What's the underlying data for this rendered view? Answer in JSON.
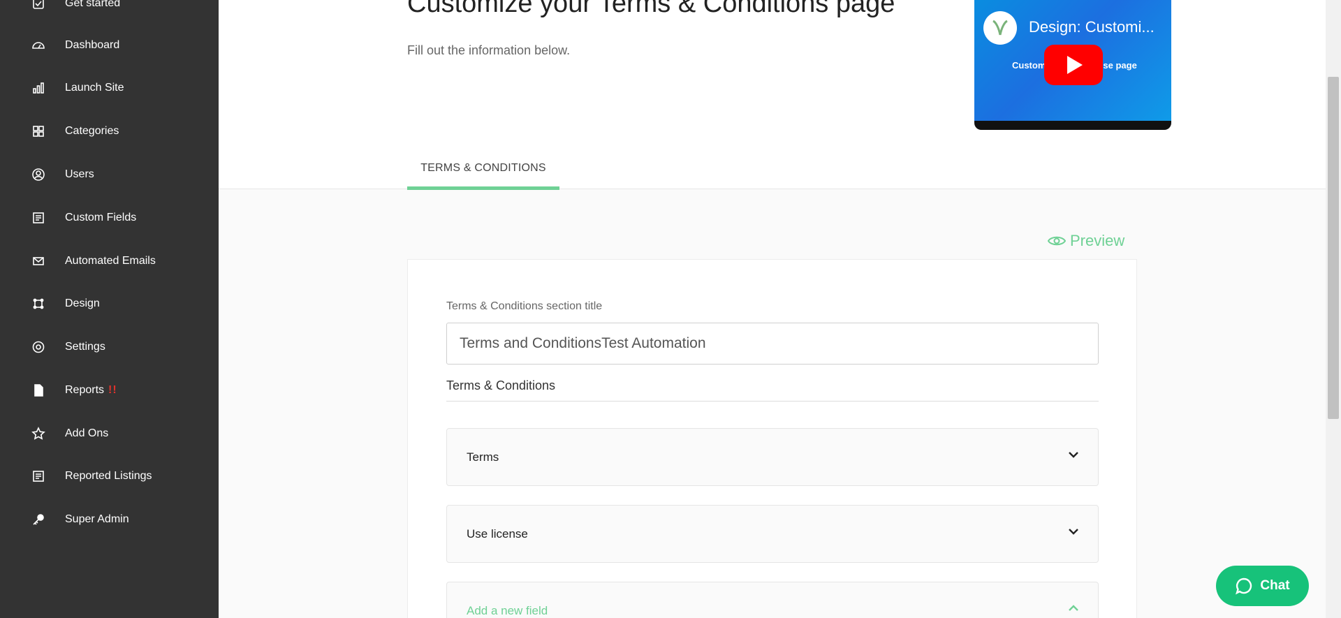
{
  "sidebar": {
    "items": [
      {
        "label": "Get started",
        "icon": "checkbox-icon"
      },
      {
        "label": "Dashboard",
        "icon": "gauge-icon"
      },
      {
        "label": "Launch Site",
        "icon": "bar-chart-icon"
      },
      {
        "label": "Categories",
        "icon": "grid-icon"
      },
      {
        "label": "Users",
        "icon": "user-circle-icon"
      },
      {
        "label": "Custom Fields",
        "icon": "list-icon"
      },
      {
        "label": "Automated Emails",
        "icon": "mail-icon"
      },
      {
        "label": "Design",
        "icon": "frame-icon"
      },
      {
        "label": "Settings",
        "icon": "gear-icon"
      },
      {
        "label": "Reports",
        "icon": "document-icon",
        "alert": "!!"
      },
      {
        "label": "Add Ons",
        "icon": "star-icon"
      },
      {
        "label": "Reported Listings",
        "icon": "list-icon"
      },
      {
        "label": "Super Admin",
        "icon": "key-icon"
      }
    ]
  },
  "header": {
    "title": "Customize your Terms & Conditions page",
    "subtitle": "Fill out the information below.",
    "tab": "TERMS & CONDITIONS"
  },
  "video": {
    "title": "Design: Customi...",
    "caption": "Custom",
    "caption_end": "se page"
  },
  "preview_label": "Preview",
  "form": {
    "section_title_label": "Terms & Conditions section title",
    "section_title_value": "Terms and ConditionsTest Automation",
    "section_heading": "Terms & Conditions",
    "accordions": [
      {
        "label": "Terms",
        "state": "collapsed"
      },
      {
        "label": "Use license",
        "state": "collapsed"
      },
      {
        "label": "Add a new field",
        "state": "expanded"
      }
    ]
  },
  "chat_label": "Chat",
  "colors": {
    "accent": "#6fd195",
    "sidebar": "#333333",
    "chat": "#17c27a",
    "alert": "#e0322b"
  }
}
